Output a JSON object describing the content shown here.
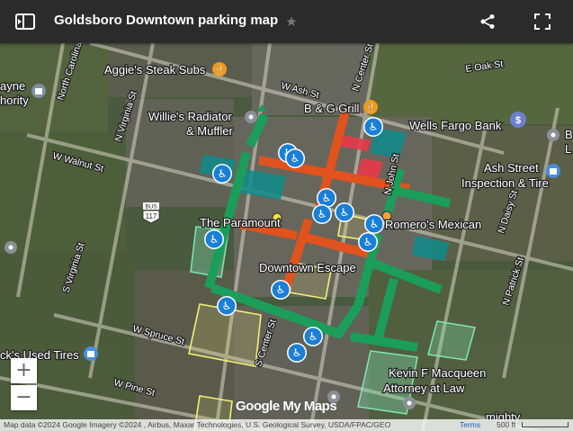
{
  "header": {
    "title": "Goldsboro Downtown parking map",
    "star_icon": "star-icon",
    "share_icon": "share-icon",
    "fullscreen_icon": "fullscreen-icon",
    "panel_icon": "side-panel-icon"
  },
  "places": {
    "aggies": "Aggie's Steak Subs",
    "willies_1": "Willie's Radiator",
    "willies_2": "& Muffler",
    "bg_grill": "B & G Grill",
    "wells_fargo": "Wells Fargo Bank",
    "ash_street_1": "Ash Street",
    "ash_street_2": "Inspection & Tire",
    "romeros": "Romero's Mexican",
    "the_paramount": "The Paramount",
    "downtown_escape": "Downtown Escape",
    "used_tires": "ck's Used Tires",
    "kevin_1": "Kevin F Macqueen",
    "kevin_2": "Attorney at Law",
    "mighty": "mighty",
    "wayne_1": "ayne",
    "wayne_2": "hority",
    "edge_b": "B",
    "edge_l": "L"
  },
  "streets": {
    "e_oak": "E Oak St",
    "w_ash": "W Ash St",
    "n_center": "N Center St",
    "n_john": "N John St",
    "n_carolina": "North Carolina",
    "n_virginia": "N Virginia St",
    "w_walnut": "W Walnut St",
    "s_virginia": "S Virginia St",
    "w_spruce": "W Spruce St",
    "s_center": "S Center St",
    "w_pine": "W Pine St",
    "n_daisy": "N Daisy St",
    "n_patrick": "N Patrick St",
    "bus_shield": "BUS",
    "route": "117"
  },
  "map_controls": {
    "zoom_in": "+",
    "zoom_out": "−"
  },
  "attribution": {
    "text": "Map data ©2024 Google Imagery ©2024 , Airbus, Maxar Technologies, U.S. Geological Survey, USDA/FPAC/GEO",
    "terms": "Terms",
    "scale": "500 ft",
    "logo": "Google My Maps"
  },
  "colors": {
    "green_parking": "#1a9e5a",
    "orange_parking": "#e0521e",
    "teal_parking": "#0e8c8c",
    "red_parking": "#e83a4a",
    "yellow_outline": "#f3ef7a",
    "accessible_pin": "#1a7fd6"
  }
}
